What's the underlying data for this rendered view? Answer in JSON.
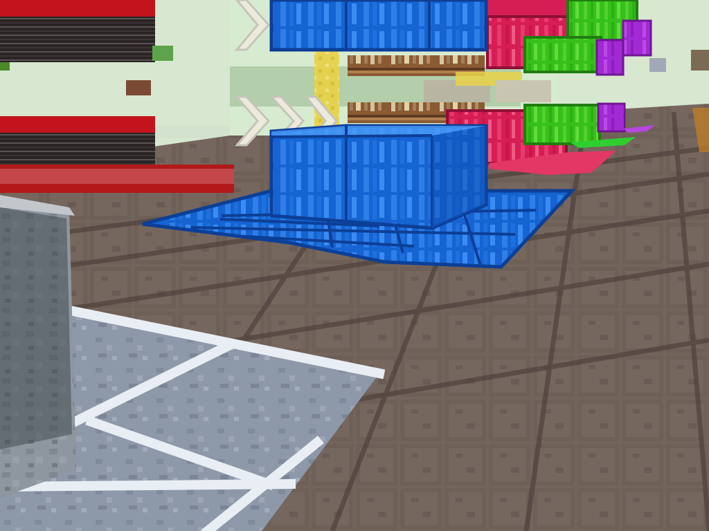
{
  "scene": {
    "kind": "voxel-game-first-person-view",
    "hud_visible": false
  },
  "palette": {
    "sky": "#2b6f8f",
    "sky_haze": "#cfe3cf",
    "wall": "#d8e7cf",
    "floor_tile": "#73645c",
    "floor_tile_dark": "#5f5149",
    "floor_grout": "#4c403a",
    "blue_block": "#1663d2",
    "blue_block_light": "#3a8cf2",
    "blue_block_dark": "#0c3f97",
    "red_block": "#d61e55",
    "red_block_dark": "#8e0f35",
    "green_block": "#37c01a",
    "green_block_dark": "#1f7e0e",
    "purple_block": "#a22ad4",
    "stone_block": "#8e969f",
    "stone_block_dark": "#4e565f",
    "slate_tile": "#8d98a9",
    "slate_grout": "#e9eef4",
    "press_black": "#2a2424",
    "press_red": "#c3141e",
    "bookshelf": "#8a5a33",
    "yellow_glass": "#e7d24a"
  }
}
